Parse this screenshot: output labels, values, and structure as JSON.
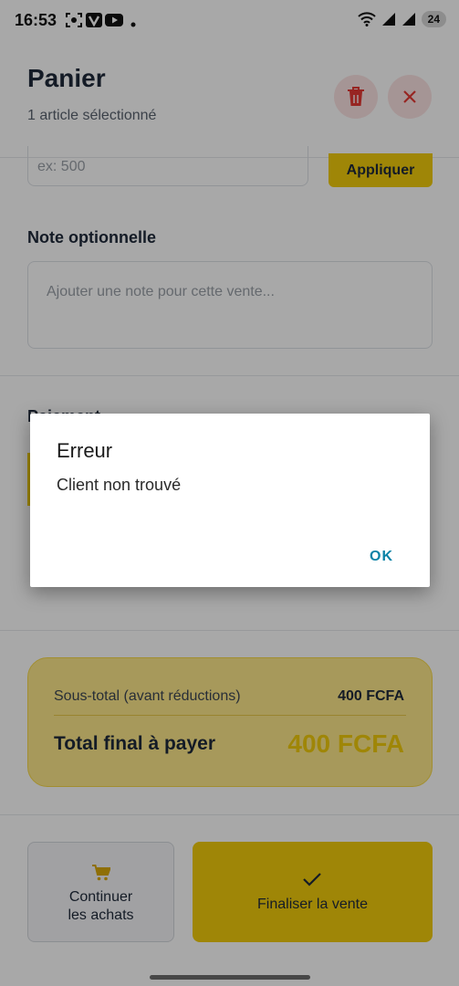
{
  "status_bar": {
    "time": "16:53",
    "battery": "24"
  },
  "header": {
    "title": "Panier",
    "subtitle": "1 article sélectionné"
  },
  "discount": {
    "placeholder": "ex: 500",
    "apply_label": "Appliquer"
  },
  "note": {
    "label": "Note optionnelle",
    "placeholder": "Ajouter une note pour cette vente..."
  },
  "payment": {
    "label": "Paiement"
  },
  "totals": {
    "subtotal_label": "Sous-total (avant réductions)",
    "subtotal_value": "400 FCFA",
    "final_label": "Total final à payer",
    "final_value": "400 FCFA"
  },
  "actions": {
    "continue_line1": "Continuer",
    "continue_line2": "les achats",
    "finalize_label": "Finaliser la vente"
  },
  "dialog": {
    "title": "Erreur",
    "message": "Client non trouvé",
    "ok_label": "OK"
  },
  "colors": {
    "accent": "#f2cc0c",
    "danger": "#e53935",
    "link": "#0a82a6"
  }
}
